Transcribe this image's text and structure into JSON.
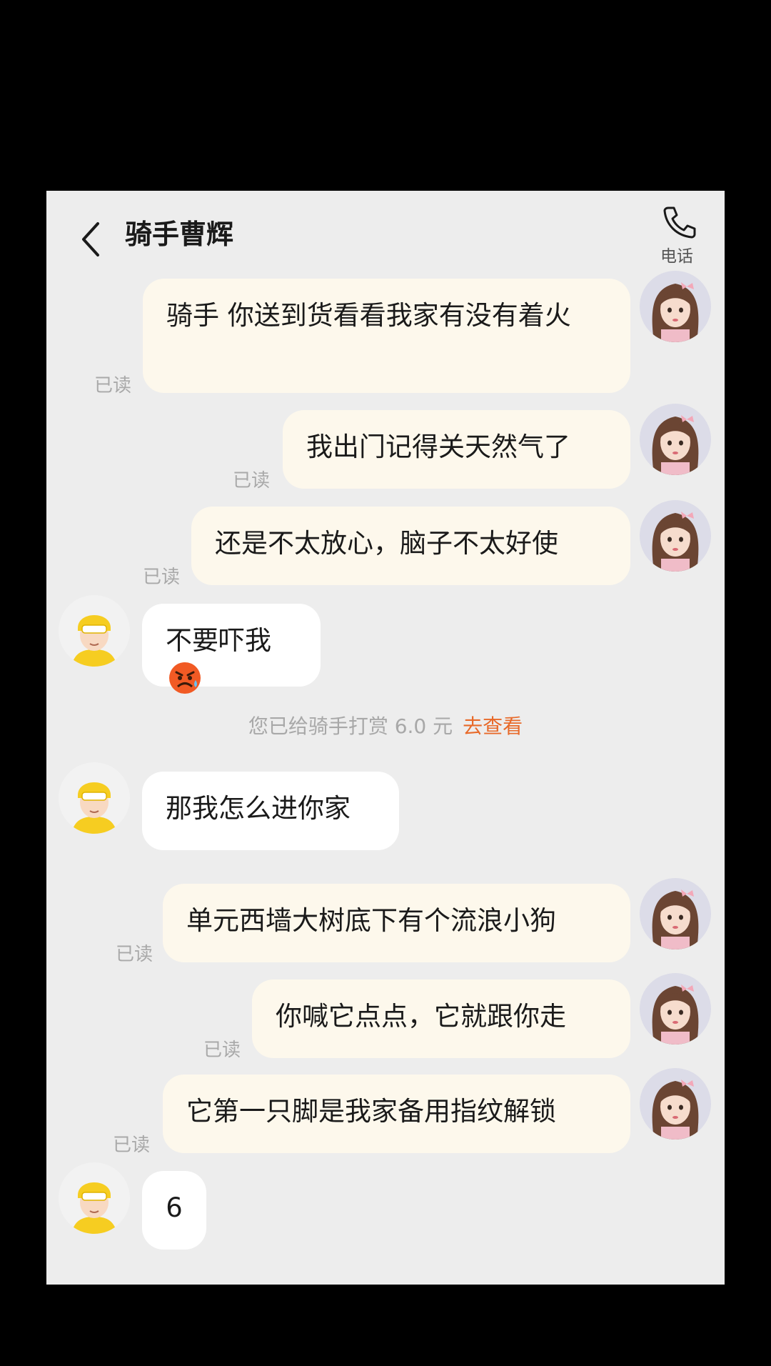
{
  "header": {
    "title": "骑手曹辉",
    "call_label": "电话"
  },
  "read_label": "已读",
  "messages": [
    {
      "from": "me",
      "text": "骑手 你送到货看看我家有没有着火"
    },
    {
      "from": "me",
      "text": "我出门记得关天然气了"
    },
    {
      "from": "me",
      "text": "还是不太放心，脑子不太好使"
    },
    {
      "from": "rider",
      "text": "不要吓我"
    },
    {
      "from": "rider",
      "text": "那我怎么进你家"
    },
    {
      "from": "me",
      "text": "单元西墙大树底下有个流浪小狗"
    },
    {
      "from": "me",
      "text": "你喊它点点，它就跟你走"
    },
    {
      "from": "me",
      "text": "它第一只脚是我家备用指纹解锁"
    },
    {
      "from": "rider",
      "text": "6"
    }
  ],
  "tip_notice": {
    "text": "您已给骑手打赏 6.0 元",
    "link": "去查看"
  },
  "colors": {
    "my_bubble": "#fdf8ec",
    "rider_bubble": "#ffffff",
    "link": "#e86a2a",
    "background": "#ededed"
  }
}
